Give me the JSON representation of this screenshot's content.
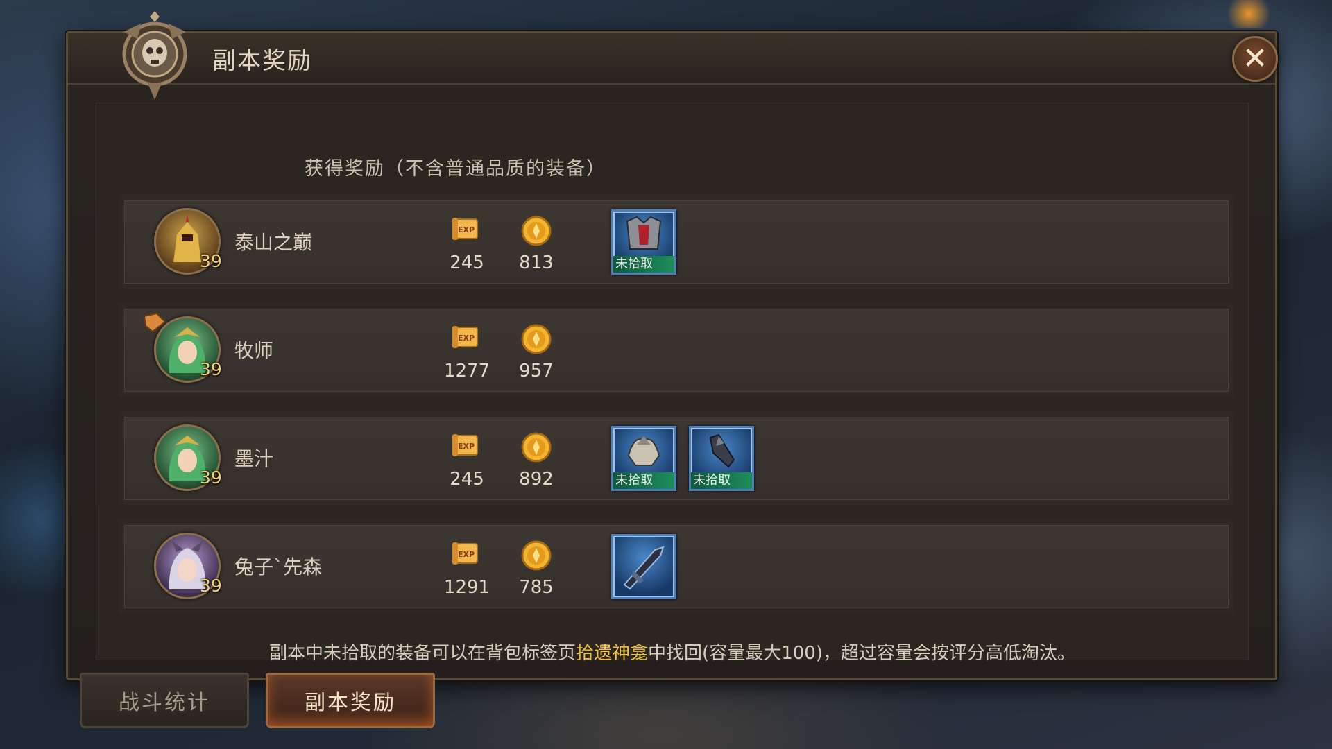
{
  "window": {
    "title": "副本奖励",
    "close_icon": "close-icon"
  },
  "subtitle": "获得奖励（不含普通品质的装备）",
  "rows": [
    {
      "name": "泰山之巅",
      "level": "39",
      "avatar": "gold-armored-warrior-avatar",
      "exp": "245",
      "gold": "813",
      "items": [
        {
          "icon": "chest-armor-icon",
          "status": "未拾取"
        }
      ]
    },
    {
      "name": "牧师",
      "level": "39",
      "avatar": "green-haired-priestess-avatar",
      "leader_badge": "leader-badge-icon",
      "exp": "1277",
      "gold": "957",
      "items": []
    },
    {
      "name": "墨汁",
      "level": "39",
      "avatar": "green-haired-priestess-avatar",
      "exp": "245",
      "gold": "892",
      "items": [
        {
          "icon": "shoulder-armor-icon",
          "status": "未拾取"
        },
        {
          "icon": "gauntlet-icon",
          "status": "未拾取"
        }
      ]
    },
    {
      "name": "兔子`先森",
      "level": "39",
      "avatar": "silver-haired-mage-avatar",
      "exp": "1291",
      "gold": "785",
      "items": [
        {
          "icon": "dark-weapon-icon",
          "status": ""
        }
      ]
    }
  ],
  "notice": {
    "before": "副本中未拾取的装备可以在背包标签页",
    "highlight": "拾遗神龛",
    "after": "中找回(容量最大100)，超过容量会按评分高低淘汰。"
  },
  "tabs": [
    {
      "label": "战斗统计",
      "active": false
    },
    {
      "label": "副本奖励",
      "active": true
    }
  ],
  "colors": {
    "accent_gold": "#f0c53a",
    "unpicked_tag": "#1d8d5b",
    "item_frame": "#4e7fb8"
  }
}
